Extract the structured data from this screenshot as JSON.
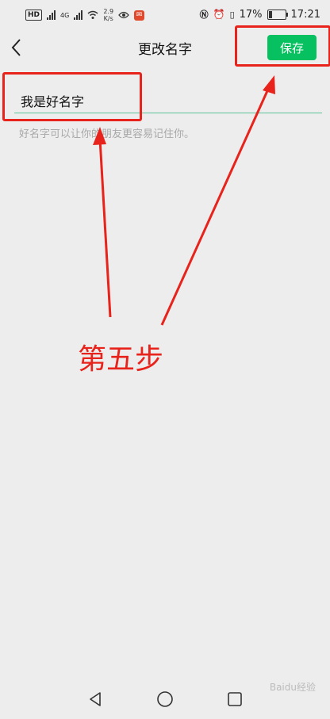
{
  "status_bar": {
    "network": "HD",
    "network_gen": "4G",
    "speed_value": "2.9",
    "speed_unit": "K/s",
    "battery": "17%",
    "time": "17:21"
  },
  "header": {
    "title": "更改名字",
    "save_label": "保存"
  },
  "form": {
    "name_value": "我是好名字",
    "hint": "好名字可以让你的朋友更容易记住你。"
  },
  "annotation": {
    "step_label": "第五步"
  },
  "watermark": "Baidu经验",
  "colors": {
    "accent": "#07c160",
    "annotation": "#e8231b",
    "background": "#ededed"
  }
}
